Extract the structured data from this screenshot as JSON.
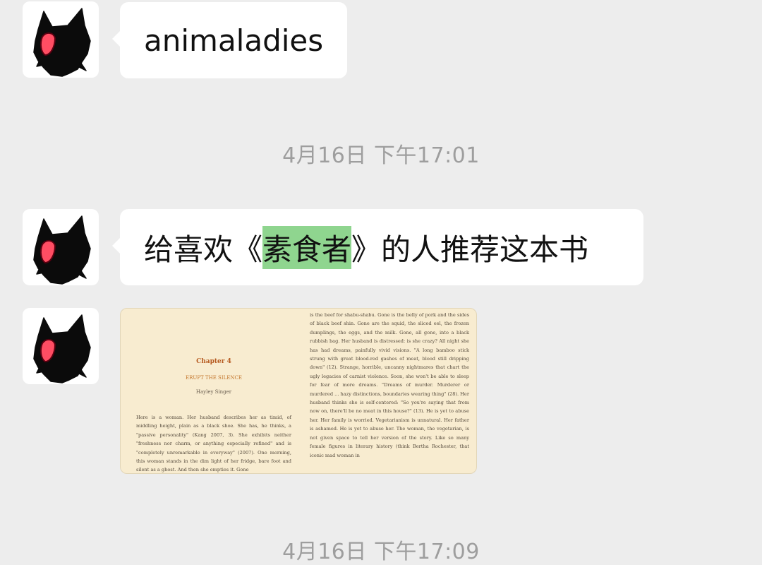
{
  "messages": [
    {
      "text": "animaladies"
    },
    {
      "text_before": "给喜欢《",
      "highlight": "素食者",
      "text_after": "》的人推荐这本书"
    }
  ],
  "timestamps": [
    "4月16日 下午17:01",
    "4月16日 下午17:09"
  ],
  "book_page": {
    "chapter": "Chapter 4",
    "subtitle": "ERUPT THE SILENCE",
    "author": "Hayley Singer",
    "left_text": "Here is a woman. Her husband describes her as timid, of middling height, plain as a black shoe. She has, he thinks, a \"passive personality\" (Kang 2007, 3). She exhibits neither \"freshness nor charm, or anything especially refined\" and is \"completely unremarkable in everyway\" (2007). One morning, this woman stands in the dim light of her fridge, bare foot and silent as a ghost. And then she empties it. Gone",
    "right_text": "is the beef for shabu-shabu. Gone is the belly of pork and the sides of black beef shin. Gone are the squid, the sliced eel, the frozen dumplings, the eggs, and the milk. Gone, all gone, into a black rubbish bag. Her husband is distressed: is she crazy? All night she has had dreams, painfully vivid visions. \"A long bamboo stick strung with great blood-red gashes of meat, blood still dripping down\" (12). Strange, horrible, uncanny nightmares that chart the ugly legacies of carnist violence. Soon, she won't be able to sleep for fear of more dreams. \"Dreams of murder. Murderer or murdered ... hazy distinctions, boundaries wearing thing\" (28). Her husband thinks she is self-centered: \"So you're saying that from now on, there'll be no meat in this house?\" (13). He is yet to abuse her. Her family is worried. Vegetarianism is unnatural. Her father is ashamed. He is yet to abuse her. The woman, the vegetarian, is not given space to tell her version of the story. Like so many female figures in literary history (think Bertha Rochester, that iconic mad woman in"
  },
  "colors": {
    "background": "#ededed",
    "bubble": "#ffffff",
    "highlight": "#8fd58f",
    "timestamp": "#9e9e9e",
    "page": "#f8ecd0"
  }
}
